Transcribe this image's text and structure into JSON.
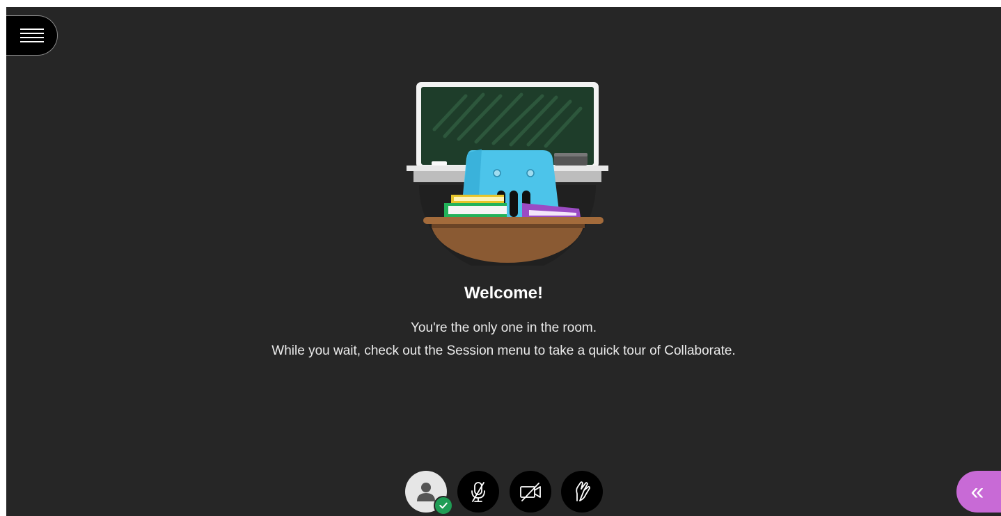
{
  "welcome": {
    "title": "Welcome!",
    "line1": "You're the only one in the room.",
    "line2": "While you wait, check out the Session menu to take a quick tour of Collaborate."
  },
  "icons": {
    "menu": "hamburger-menu-icon",
    "avatar": "user-avatar-icon",
    "status": "checkmark-icon",
    "mic": "microphone-muted-icon",
    "camera": "camera-off-icon",
    "hand": "raise-hand-icon",
    "panel": "double-chevron-left-icon"
  },
  "colors": {
    "background": "#262626",
    "panel_accent": "#c86ad6",
    "status_green": "#1f9d55",
    "chalkboard": "#1e3d2a",
    "chair": "#4cc4ea"
  }
}
